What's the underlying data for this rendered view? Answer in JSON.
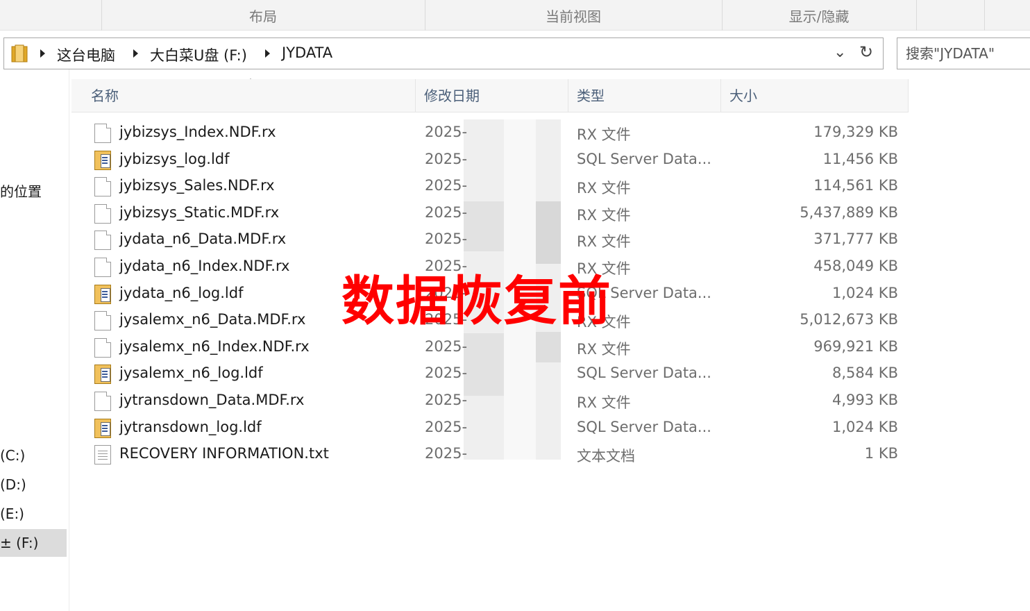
{
  "ribbon": {
    "groups": [
      "布局",
      "当前视图",
      "显示/隐藏"
    ]
  },
  "address": {
    "crumbs": [
      "这台电脑",
      "大白菜U盘 (F:)",
      "JYDATA"
    ],
    "dropdown_icon": "chevron-down-icon",
    "refresh_icon": "refresh-icon"
  },
  "search": {
    "placeholder": "搜索\"JYDATA\""
  },
  "nav": {
    "items": [
      {
        "label": "的位置",
        "selected": false
      },
      {
        "label": "(C:)",
        "selected": false
      },
      {
        "label": "(D:)",
        "selected": false
      },
      {
        "label": "(E:)",
        "selected": false
      },
      {
        "label": "± (F:)",
        "selected": true
      }
    ]
  },
  "columns": {
    "name": "名称",
    "date": "修改日期",
    "type": "类型",
    "size": "大小",
    "sort": "name-ascending"
  },
  "files": [
    {
      "name": "jybizsys_Index.NDF.rx",
      "date": "2025-",
      "type": "RX 文件",
      "size": "179,329 KB",
      "icon": "blank-file-icon"
    },
    {
      "name": "jybizsys_log.ldf",
      "date": "2025-",
      "type": "SQL Server Data...",
      "size": "11,456 KB",
      "icon": "sql-log-file-icon"
    },
    {
      "name": "jybizsys_Sales.NDF.rx",
      "date": "2025-",
      "type": "RX 文件",
      "size": "114,561 KB",
      "icon": "blank-file-icon"
    },
    {
      "name": "jybizsys_Static.MDF.rx",
      "date": "2025-",
      "type": "RX 文件",
      "size": "5,437,889 KB",
      "icon": "blank-file-icon"
    },
    {
      "name": "jydata_n6_Data.MDF.rx",
      "date": "2025-",
      "type": "RX 文件",
      "size": "371,777 KB",
      "icon": "blank-file-icon"
    },
    {
      "name": "jydata_n6_Index.NDF.rx",
      "date": "2025-",
      "type": "RX 文件",
      "size": "458,049 KB",
      "icon": "blank-file-icon"
    },
    {
      "name": "jydata_n6_log.ldf",
      "date": "2025-",
      "type": "SQL Server Data...",
      "size": "1,024 KB",
      "icon": "sql-log-file-icon"
    },
    {
      "name": "jysalemx_n6_Data.MDF.rx",
      "date": "2025-",
      "type": "RX 文件",
      "size": "5,012,673 KB",
      "icon": "blank-file-icon"
    },
    {
      "name": "jysalemx_n6_Index.NDF.rx",
      "date": "2025-",
      "type": "RX 文件",
      "size": "969,921 KB",
      "icon": "blank-file-icon"
    },
    {
      "name": "jysalemx_n6_log.ldf",
      "date": "2025-",
      "type": "SQL Server Data...",
      "size": "8,584 KB",
      "icon": "sql-log-file-icon"
    },
    {
      "name": "jytransdown_Data.MDF.rx",
      "date": "2025-",
      "type": "RX 文件",
      "size": "4,993 KB",
      "icon": "blank-file-icon"
    },
    {
      "name": "jytransdown_log.ldf",
      "date": "2025-",
      "type": "SQL Server Data...",
      "size": "1,024 KB",
      "icon": "sql-log-file-icon"
    },
    {
      "name": "RECOVERY INFORMATION.txt",
      "date": "2025-",
      "type": "文本文档",
      "size": "1 KB",
      "icon": "text-file-icon"
    }
  ],
  "overlay": {
    "text": "数据恢复前",
    "color": "#ff0000"
  }
}
